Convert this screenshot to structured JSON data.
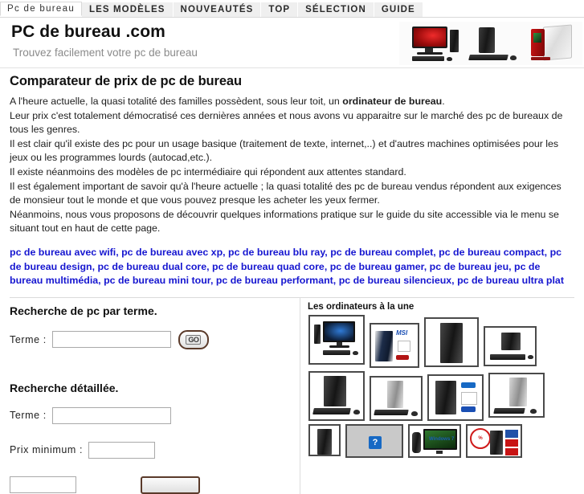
{
  "nav": {
    "items": [
      {
        "label": "Pc de bureau",
        "active": true
      },
      {
        "label": "LES MODÈLES",
        "active": false
      },
      {
        "label": "NOUVEAUTÉS",
        "active": false
      },
      {
        "label": "TOP",
        "active": false
      },
      {
        "label": "SÉLECTION",
        "active": false
      },
      {
        "label": "GUIDE",
        "active": false
      }
    ]
  },
  "header": {
    "title": "PC de bureau .com",
    "tagline": "Trouvez facilement votre pc de bureau"
  },
  "main": {
    "title": "Comparateur de prix de pc de bureau",
    "paragraphs": [
      "A l'heure actuelle, la quasi totalité des familles possèdent, sous leur toit, un ",
      "Leur prix c'est totalement démocratisé ces dernières années et nous avons vu apparaitre sur le marché des pc de bureaux de tous les genres.",
      "Il est clair qu'il existe des pc pour un usage basique (traitement de texte, internet,..) et d'autres machines optimisées pour les jeux ou les programmes lourds (autocad,etc.).",
      "Il existe néanmoins des modèles de pc intermédiaire qui répondent aux attentes standard.",
      "Il est également important de savoir qu'à l'heure actuelle ; la quasi totalité des pc de bureau vendus répondent aux exigences de monsieur tout le monde et que vous pouvez presque les acheter les yeux fermer.",
      "Néanmoins, nous vous proposons de découvrir quelques informations pratique sur le guide du site accessible via le menu se situant tout en haut de cette page."
    ],
    "p1_bold": "ordinateur de bureau",
    "p1_tail": ".",
    "keywords": [
      "pc de bureau avec wifi",
      "pc de bureau avec xp",
      "pc de bureau blu ray",
      "pc de bureau complet",
      "pc de bureau compact",
      "pc de bureau design",
      "pc de bureau dual core",
      "pc de bureau quad core",
      "pc de bureau gamer",
      "pc de bureau jeu",
      "pc de bureau multimédia",
      "pc de bureau mini tour",
      "pc de bureau performant",
      "pc de bureau silencieux",
      "pc de bureau ultra plat"
    ],
    "keyword_separator": ", "
  },
  "search_simple": {
    "title": "Recherche de pc par terme.",
    "term_label": "Terme :",
    "term_value": "",
    "term_placeholder": "",
    "go_label": "GO"
  },
  "search_detailed": {
    "title": "Recherche détaillée.",
    "term_label": "Terme :",
    "term_value": "",
    "term_placeholder": "",
    "price_min_label": "Prix minimum :",
    "price_min_value": "",
    "price_min_placeholder": ""
  },
  "sidebar": {
    "title": "Les ordinateurs à la une",
    "thumbs": [
      {
        "name": "desktop-monitor-tower-keyboard"
      },
      {
        "name": "msi-tower-with-logos"
      },
      {
        "name": "dell-black-tower"
      },
      {
        "name": "compact-pc-with-keyboard"
      },
      {
        "name": "black-tower-with-keyboard"
      },
      {
        "name": "silver-slim-pc-keyboard"
      },
      {
        "name": "asus-black-tower-badges"
      },
      {
        "name": "silver-tower-keyboard-mouse"
      },
      {
        "name": "small-black-tower"
      },
      {
        "name": "placeholder-missing-image"
      },
      {
        "name": "windows-7-monitor-tower"
      },
      {
        "name": "promo-tower-with-price-badge"
      }
    ],
    "placeholder_glyph": "?",
    "badge_msi": "MSI",
    "badge_windows": "Windows 7",
    "badge_promo": "100% PROMO"
  }
}
